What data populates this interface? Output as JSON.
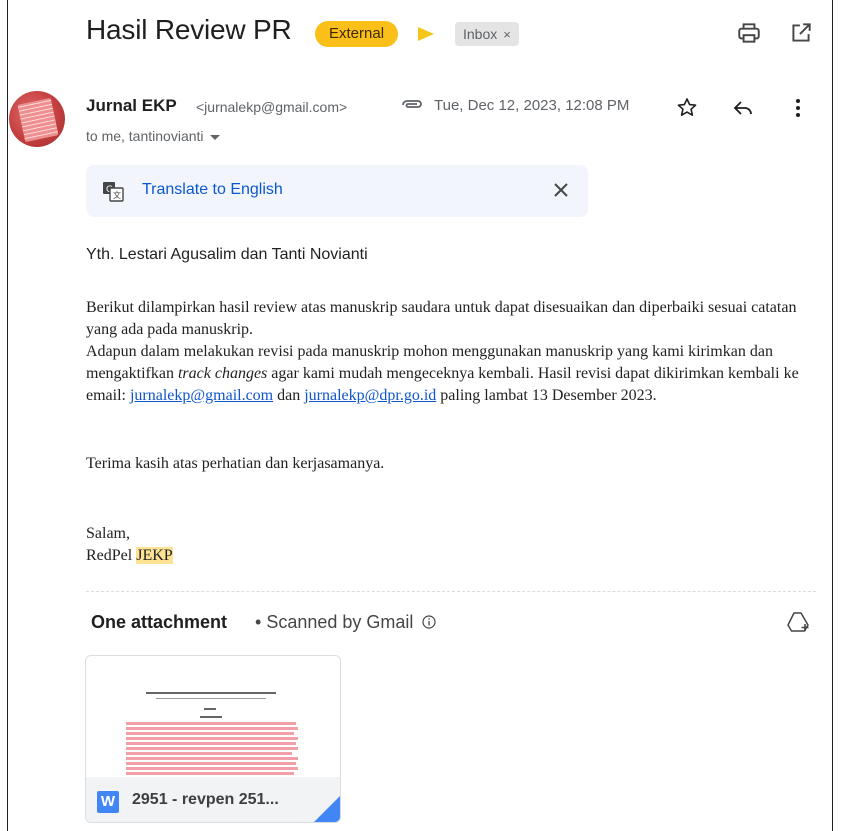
{
  "email": {
    "subject": "Hasil Review PR",
    "labels": {
      "external": "External",
      "inbox": "Inbox",
      "inbox_remove": "×"
    },
    "sender": {
      "name": "Jurnal EKP",
      "email": "<jurnalekp@gmail.com>"
    },
    "date": "Tue, Dec 12, 2023, 12:08 PM",
    "recipients": "to me, tantinovianti",
    "translate": {
      "link": "Translate to English",
      "close": "✕"
    },
    "greeting": "Yth. Lestari Agusalim dan Tanti Novianti",
    "body": {
      "p1": "Berikut dilampirkan hasil review atas manuskrip saudara untuk dapat disesuaikan dan diperbaiki sesuai catatan yang ada pada manuskrip.",
      "p2_part1": "Adapun dalam melakukan revisi pada manuskrip mohon menggunakan manuskrip yang kami kirimkan dan mengaktifkan ",
      "p2_italic": "track changes",
      "p2_part2": " agar kami mudah mengeceknya kembali. Hasil revisi dapat dikirimkan kembali ke email: ",
      "link1": "jurnalekp@gmail.com",
      "p2_dan": " dan ",
      "link2": "jurnalekp@dpr.go.id",
      "p2_part3": " paling lambat 13 Desember 2023.",
      "p3": "Terima kasih atas perhatian dan kerjasamanya.",
      "closing": "Salam,",
      "signature_prefix": "RedPel ",
      "signature_highlight": "JEKP"
    },
    "attachments": {
      "title": "One attachment",
      "separator": "•",
      "scanned": "Scanned by Gmail",
      "file": {
        "type_badge": "W",
        "name": "2951 - revpen 251..."
      }
    }
  },
  "icons": {
    "print": "print-icon",
    "open_new_window": "open-in-new-window-icon",
    "attachment_clip": "paperclip-icon",
    "star": "star-icon",
    "reply": "reply-icon",
    "more": "more-vert-icon",
    "translate": "translate-icon",
    "drive": "add-to-drive-icon",
    "info": "info-icon"
  },
  "colors": {
    "external_label": "#fbbf1a",
    "importance_marker": "#f5c518",
    "link": "#1155cc",
    "translate_link": "#0b57d0",
    "highlight": "#fde293",
    "word_badge": "#4285f4"
  }
}
